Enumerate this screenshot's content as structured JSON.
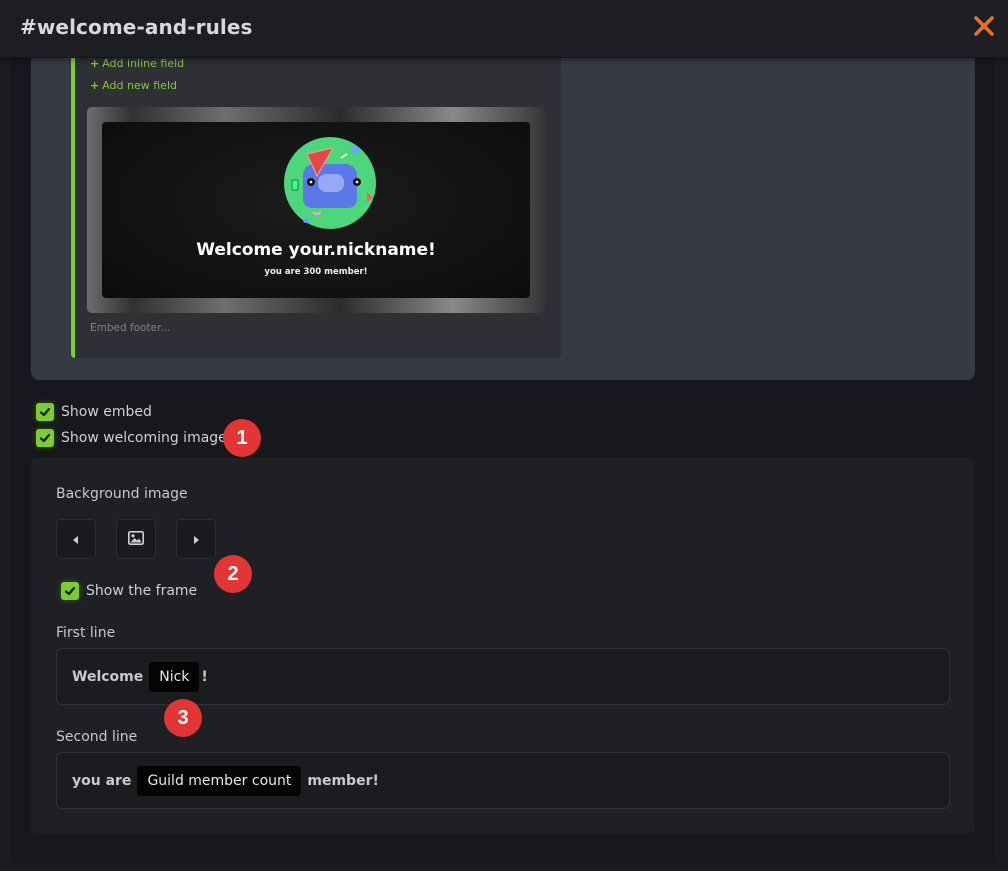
{
  "header": {
    "title": "#welcome-and-rules"
  },
  "embed": {
    "add_inline_field": "Add inline field",
    "add_new_field": "Add new field",
    "footer_placeholder": "Embed footer...",
    "card": {
      "headline": "Welcome your.nickname!",
      "subline": "you are 300 member!"
    }
  },
  "options": {
    "show_embed": {
      "label": "Show embed",
      "checked": true
    },
    "show_welcoming_image": {
      "label": "Show welcoming image",
      "checked": true
    }
  },
  "settings": {
    "background_image_label": "Background image",
    "show_frame": {
      "label": "Show the frame",
      "checked": true
    },
    "first_line": {
      "label": "First line",
      "prefix": "Welcome",
      "chip": "Nick",
      "suffix": "!"
    },
    "second_line": {
      "label": "Second line",
      "prefix": "you are",
      "chip": "Guild member count",
      "suffix": "member!"
    }
  },
  "annotations": [
    "1",
    "2",
    "3"
  ],
  "colors": {
    "accent": "#7ccd2e",
    "close": "#e8702a",
    "badge": "#e23636"
  },
  "icons": {
    "close": "close-icon",
    "prev": "caret-left-icon",
    "image": "image-icon",
    "next": "caret-right-icon",
    "check": "checkmark-icon"
  }
}
